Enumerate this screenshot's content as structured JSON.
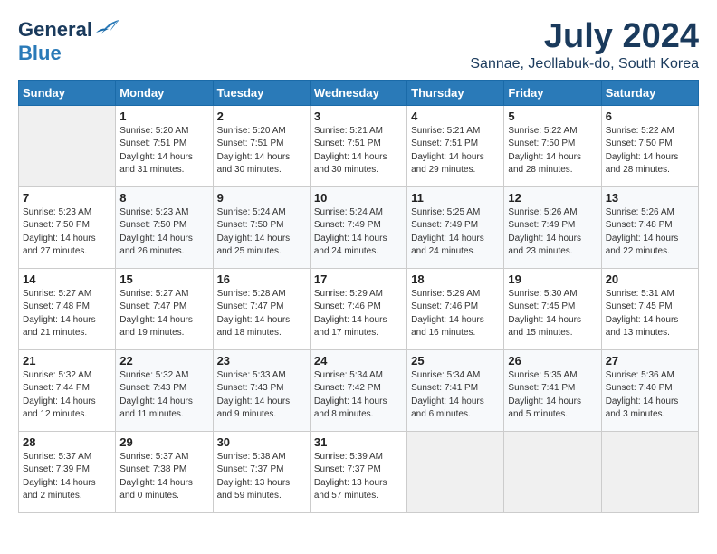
{
  "logo": {
    "general": "General",
    "blue": "Blue"
  },
  "title": "July 2024",
  "location": "Sannae, Jeollabuk-do, South Korea",
  "days_of_week": [
    "Sunday",
    "Monday",
    "Tuesday",
    "Wednesday",
    "Thursday",
    "Friday",
    "Saturday"
  ],
  "weeks": [
    [
      {
        "num": "",
        "sunrise": "",
        "sunset": "",
        "daylight": ""
      },
      {
        "num": "1",
        "sunrise": "Sunrise: 5:20 AM",
        "sunset": "Sunset: 7:51 PM",
        "daylight": "Daylight: 14 hours and 31 minutes."
      },
      {
        "num": "2",
        "sunrise": "Sunrise: 5:20 AM",
        "sunset": "Sunset: 7:51 PM",
        "daylight": "Daylight: 14 hours and 30 minutes."
      },
      {
        "num": "3",
        "sunrise": "Sunrise: 5:21 AM",
        "sunset": "Sunset: 7:51 PM",
        "daylight": "Daylight: 14 hours and 30 minutes."
      },
      {
        "num": "4",
        "sunrise": "Sunrise: 5:21 AM",
        "sunset": "Sunset: 7:51 PM",
        "daylight": "Daylight: 14 hours and 29 minutes."
      },
      {
        "num": "5",
        "sunrise": "Sunrise: 5:22 AM",
        "sunset": "Sunset: 7:50 PM",
        "daylight": "Daylight: 14 hours and 28 minutes."
      },
      {
        "num": "6",
        "sunrise": "Sunrise: 5:22 AM",
        "sunset": "Sunset: 7:50 PM",
        "daylight": "Daylight: 14 hours and 28 minutes."
      }
    ],
    [
      {
        "num": "7",
        "sunrise": "Sunrise: 5:23 AM",
        "sunset": "Sunset: 7:50 PM",
        "daylight": "Daylight: 14 hours and 27 minutes."
      },
      {
        "num": "8",
        "sunrise": "Sunrise: 5:23 AM",
        "sunset": "Sunset: 7:50 PM",
        "daylight": "Daylight: 14 hours and 26 minutes."
      },
      {
        "num": "9",
        "sunrise": "Sunrise: 5:24 AM",
        "sunset": "Sunset: 7:50 PM",
        "daylight": "Daylight: 14 hours and 25 minutes."
      },
      {
        "num": "10",
        "sunrise": "Sunrise: 5:24 AM",
        "sunset": "Sunset: 7:49 PM",
        "daylight": "Daylight: 14 hours and 24 minutes."
      },
      {
        "num": "11",
        "sunrise": "Sunrise: 5:25 AM",
        "sunset": "Sunset: 7:49 PM",
        "daylight": "Daylight: 14 hours and 24 minutes."
      },
      {
        "num": "12",
        "sunrise": "Sunrise: 5:26 AM",
        "sunset": "Sunset: 7:49 PM",
        "daylight": "Daylight: 14 hours and 23 minutes."
      },
      {
        "num": "13",
        "sunrise": "Sunrise: 5:26 AM",
        "sunset": "Sunset: 7:48 PM",
        "daylight": "Daylight: 14 hours and 22 minutes."
      }
    ],
    [
      {
        "num": "14",
        "sunrise": "Sunrise: 5:27 AM",
        "sunset": "Sunset: 7:48 PM",
        "daylight": "Daylight: 14 hours and 21 minutes."
      },
      {
        "num": "15",
        "sunrise": "Sunrise: 5:27 AM",
        "sunset": "Sunset: 7:47 PM",
        "daylight": "Daylight: 14 hours and 19 minutes."
      },
      {
        "num": "16",
        "sunrise": "Sunrise: 5:28 AM",
        "sunset": "Sunset: 7:47 PM",
        "daylight": "Daylight: 14 hours and 18 minutes."
      },
      {
        "num": "17",
        "sunrise": "Sunrise: 5:29 AM",
        "sunset": "Sunset: 7:46 PM",
        "daylight": "Daylight: 14 hours and 17 minutes."
      },
      {
        "num": "18",
        "sunrise": "Sunrise: 5:29 AM",
        "sunset": "Sunset: 7:46 PM",
        "daylight": "Daylight: 14 hours and 16 minutes."
      },
      {
        "num": "19",
        "sunrise": "Sunrise: 5:30 AM",
        "sunset": "Sunset: 7:45 PM",
        "daylight": "Daylight: 14 hours and 15 minutes."
      },
      {
        "num": "20",
        "sunrise": "Sunrise: 5:31 AM",
        "sunset": "Sunset: 7:45 PM",
        "daylight": "Daylight: 14 hours and 13 minutes."
      }
    ],
    [
      {
        "num": "21",
        "sunrise": "Sunrise: 5:32 AM",
        "sunset": "Sunset: 7:44 PM",
        "daylight": "Daylight: 14 hours and 12 minutes."
      },
      {
        "num": "22",
        "sunrise": "Sunrise: 5:32 AM",
        "sunset": "Sunset: 7:43 PM",
        "daylight": "Daylight: 14 hours and 11 minutes."
      },
      {
        "num": "23",
        "sunrise": "Sunrise: 5:33 AM",
        "sunset": "Sunset: 7:43 PM",
        "daylight": "Daylight: 14 hours and 9 minutes."
      },
      {
        "num": "24",
        "sunrise": "Sunrise: 5:34 AM",
        "sunset": "Sunset: 7:42 PM",
        "daylight": "Daylight: 14 hours and 8 minutes."
      },
      {
        "num": "25",
        "sunrise": "Sunrise: 5:34 AM",
        "sunset": "Sunset: 7:41 PM",
        "daylight": "Daylight: 14 hours and 6 minutes."
      },
      {
        "num": "26",
        "sunrise": "Sunrise: 5:35 AM",
        "sunset": "Sunset: 7:41 PM",
        "daylight": "Daylight: 14 hours and 5 minutes."
      },
      {
        "num": "27",
        "sunrise": "Sunrise: 5:36 AM",
        "sunset": "Sunset: 7:40 PM",
        "daylight": "Daylight: 14 hours and 3 minutes."
      }
    ],
    [
      {
        "num": "28",
        "sunrise": "Sunrise: 5:37 AM",
        "sunset": "Sunset: 7:39 PM",
        "daylight": "Daylight: 14 hours and 2 minutes."
      },
      {
        "num": "29",
        "sunrise": "Sunrise: 5:37 AM",
        "sunset": "Sunset: 7:38 PM",
        "daylight": "Daylight: 14 hours and 0 minutes."
      },
      {
        "num": "30",
        "sunrise": "Sunrise: 5:38 AM",
        "sunset": "Sunset: 7:37 PM",
        "daylight": "Daylight: 13 hours and 59 minutes."
      },
      {
        "num": "31",
        "sunrise": "Sunrise: 5:39 AM",
        "sunset": "Sunset: 7:37 PM",
        "daylight": "Daylight: 13 hours and 57 minutes."
      },
      {
        "num": "",
        "sunrise": "",
        "sunset": "",
        "daylight": ""
      },
      {
        "num": "",
        "sunrise": "",
        "sunset": "",
        "daylight": ""
      },
      {
        "num": "",
        "sunrise": "",
        "sunset": "",
        "daylight": ""
      }
    ]
  ]
}
